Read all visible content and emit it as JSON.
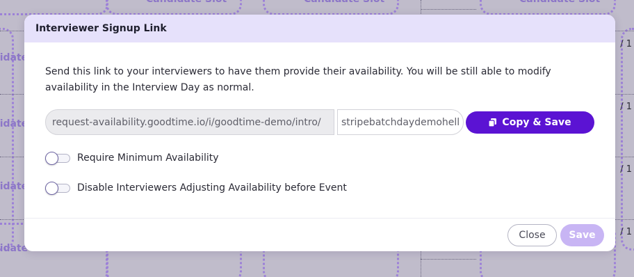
{
  "background": {
    "slot_label": "Candidate Slot",
    "fraction_label": "/ 1"
  },
  "modal": {
    "title": "Interviewer Signup Link",
    "description": "Send this link to your interviewers to have them provide their availability. You will be still able to modify availability in the Interview Day as normal.",
    "link": {
      "prefix": "request-availability.goodtime.io/i/goodtime-demo/intro/",
      "suffix_value": "stripebatchdaydemohello"
    },
    "copy_button_label": "Copy & Save",
    "toggles": [
      {
        "label": "Require Minimum Availability",
        "on": false
      },
      {
        "label": "Disable Interviewers Adjusting Availability before Event",
        "on": false
      }
    ],
    "footer": {
      "close_label": "Close",
      "save_label": "Save"
    }
  },
  "colors": {
    "header_bg": "#e6e1fb",
    "primary": "#5b13d3",
    "primary_disabled": "#c8b5f4",
    "overlay_bg": "#c0bccb"
  },
  "icons": {
    "copy": "copy-icon"
  }
}
